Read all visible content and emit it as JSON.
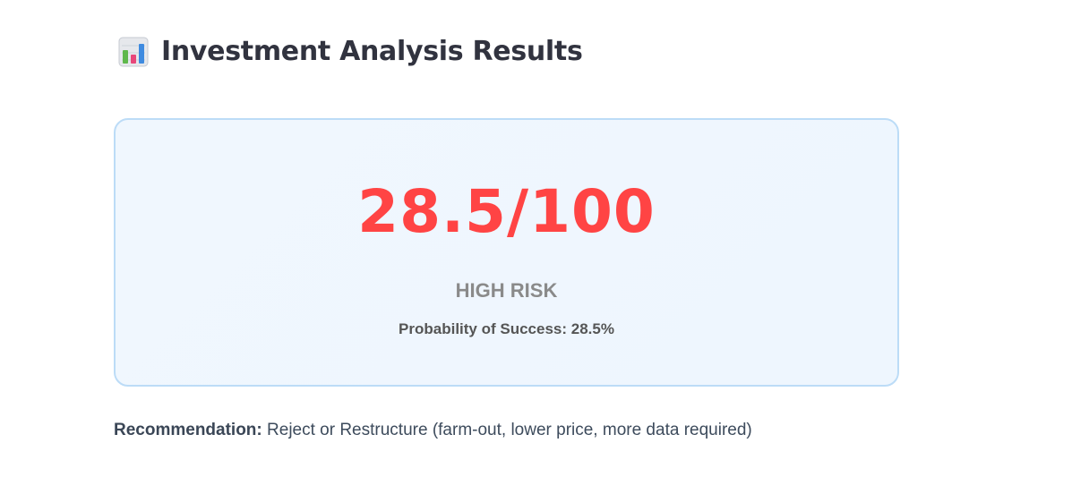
{
  "header": {
    "icon": "bar-chart-icon",
    "title": "Investment Analysis Results"
  },
  "score_card": {
    "score": "28.5/100",
    "risk_level": "HIGH RISK",
    "probability_text": "Probability of Success: 28.5%",
    "colors": {
      "score": "#ff4444",
      "risk": "#8a8a8a",
      "border": "#bcdcf7",
      "background": "#f0f7fe"
    }
  },
  "recommendation": {
    "label": "Recommendation:",
    "text": "Reject or Restructure (farm-out, lower price, more data required)"
  }
}
